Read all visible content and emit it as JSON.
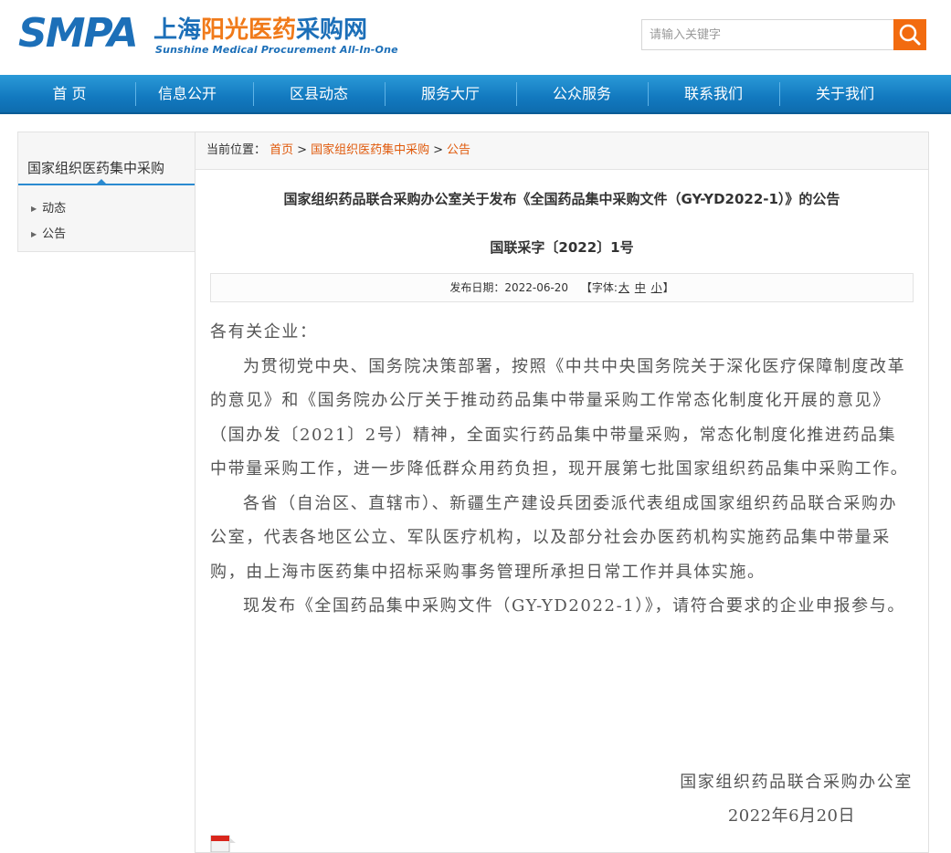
{
  "header": {
    "logo": {
      "smpa": "SMPA",
      "cn_part1": "上海",
      "cn_part2": "阳光",
      "cn_part3": "医药",
      "cn_part4": "采购网",
      "en": "Sunshine Medical Procurement All-In-One"
    },
    "search": {
      "placeholder": "请输入关键字",
      "button_icon": "search-icon"
    }
  },
  "nav": {
    "items": [
      "首 页",
      "信息公开",
      "区县动态",
      "服务大厅",
      "公众服务",
      "联系我们",
      "关于我们"
    ]
  },
  "sidebar": {
    "title": "国家组织医药集中采购",
    "items": [
      "动态",
      "公告"
    ]
  },
  "breadcrumb": {
    "label": "当前位置：",
    "items": [
      "首页",
      "国家组织医药集中采购",
      "公告"
    ]
  },
  "article": {
    "title": "国家组织药品联合采购办公室关于发布《全国药品集中采购文件（GY-YD2022-1）》的公告",
    "doc_number": "国联采字〔2022〕1号",
    "meta": {
      "date_label": "发布日期：",
      "date": "2022-06-20",
      "font_label_open": "【字体:",
      "font_large": "大",
      "font_medium": "中",
      "font_small": "小",
      "font_label_close": "】"
    },
    "salutation": "各有关企业：",
    "paragraphs": [
      "为贯彻党中央、国务院决策部署，按照《中共中央国务院关于深化医疗保障制度改革的意见》和《国务院办公厅关于推动药品集中带量采购工作常态化制度化开展的意见》（国办发〔2021〕2号）精神，全面实行药品集中带量采购，常态化制度化推进药品集中带量采购工作，进一步降低群众用药负担，现开展第七批国家组织药品集中采购工作。",
      "各省（自治区、直辖市）、新疆生产建设兵团委派代表组成国家组织药品联合采购办公室，代表各地区公立、军队医疗机构，以及部分社会办医药机构实施药品集中带量采购，由上海市医药集中招标采购事务管理所承担日常工作并具体实施。",
      "现发布《全国药品集中采购文件（GY-YD2022-1）》，请符合要求的企业申报参与。"
    ],
    "signature_org": "国家组织药品联合采购办公室",
    "signature_date": "2022年6月20日"
  },
  "colors": {
    "brand_blue": "#1c6fb8",
    "brand_orange": "#f07a1a",
    "link_orange": "#e05a0c",
    "nav_blue": "#1279bf"
  }
}
